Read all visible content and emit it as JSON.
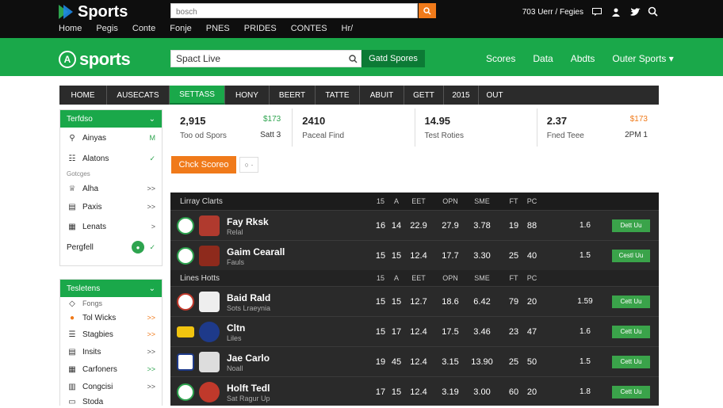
{
  "top": {
    "logo": "Sports",
    "nav": [
      "Home",
      "Pegis",
      "Conte",
      "Fonje",
      "PNES",
      "PRIDES",
      "CONTES",
      "Hr/"
    ],
    "search_placeholder": "bosch",
    "user_text": "703 Uerr / Fegies"
  },
  "header": {
    "logo": "sports",
    "search_value": "Spact Live",
    "get_button": "Gatd Spores",
    "links": [
      "Scores",
      "Data",
      "Abdts",
      "Outer Sports ▾"
    ]
  },
  "tabs": [
    {
      "label": "HOME",
      "active": false
    },
    {
      "label": "AUSECATS",
      "active": false
    },
    {
      "label": "SETTASS",
      "active": true
    },
    {
      "label": "HONY",
      "active": false
    },
    {
      "label": "BEERT",
      "active": false
    },
    {
      "label": "TATTE",
      "active": false
    },
    {
      "label": "ABUIT",
      "active": false
    },
    {
      "label": "GETT",
      "active": false
    },
    {
      "label": "2015",
      "active": false
    },
    {
      "label": "OUT",
      "active": false
    }
  ],
  "sidebar1": {
    "title": "Terfdso",
    "items": [
      {
        "label": "Ainyas",
        "right": "M"
      },
      {
        "label": "Alatons",
        "right": "✓"
      },
      {
        "label": "Alha",
        "right": ">>"
      },
      {
        "label": "Paxis",
        "right": ">>"
      },
      {
        "label": "Lenats",
        "right": ">"
      },
      {
        "label": "Pergfell",
        "right": "✓"
      }
    ],
    "sub": "Gotcges"
  },
  "sidebar2": {
    "title": "Tesletens",
    "items": [
      {
        "label": "Fongs",
        "right": ""
      },
      {
        "label": "Tol Wicks",
        "right": ">>"
      },
      {
        "label": "Stagbies",
        "right": ">>"
      },
      {
        "label": "Insits",
        "right": ">>"
      },
      {
        "label": "Carfoners",
        "right": ">>"
      },
      {
        "label": "Congcisi",
        "right": ">>"
      },
      {
        "label": "Stoda",
        "right": ""
      }
    ]
  },
  "stats": [
    {
      "value": "2,915",
      "label": "Too od Spors",
      "side": "$173",
      "side2": "Satt 3"
    },
    {
      "value": "2410",
      "label": "Paceal Find",
      "side": "",
      "side2": ""
    },
    {
      "value": "14.95",
      "label": "Test Roties",
      "side": "",
      "side2": ""
    },
    {
      "value": "2.37",
      "label": "Fned Teee",
      "side": "$173",
      "side2": "2PM 1"
    }
  ],
  "check_button": "Chck Scoreo",
  "check_toggle": "○ ·",
  "table": {
    "header1": {
      "title": "Lirray Clarts",
      "cols": [
        "15",
        "A",
        "EET",
        "OPN",
        "SME",
        "FT",
        "PC"
      ]
    },
    "header2": {
      "title": "Lines Hotts",
      "cols": [
        "15",
        "A",
        "EET",
        "OPN",
        "SME",
        "FT",
        "PC"
      ]
    },
    "rows": [
      {
        "name": "Fay Rksk",
        "sub": "Relal",
        "vals": [
          "16",
          "14",
          "22.9",
          "27.9",
          "3.78",
          "19",
          "88"
        ],
        "odds": "1.6",
        "btn": "Dett Uu"
      },
      {
        "name": "Gaim Cearall",
        "sub": "Fauls",
        "vals": [
          "15",
          "15",
          "12.4",
          "17.7",
          "3.30",
          "25",
          "40"
        ],
        "odds": "1.5",
        "btn": "Cestl Uu"
      },
      {
        "name": "Baid Rald",
        "sub": "Sots Lraeynia",
        "vals": [
          "15",
          "15",
          "12.7",
          "18.6",
          "6.42",
          "79",
          "20"
        ],
        "odds": "1.59",
        "btn": "Cett Uu"
      },
      {
        "name": "Cltn",
        "sub": "Liles",
        "vals": [
          "15",
          "17",
          "12.4",
          "17.5",
          "3.46",
          "23",
          "47"
        ],
        "odds": "1.6",
        "btn": "Cett Uu"
      },
      {
        "name": "Jae Carlo",
        "sub": "Noall",
        "vals": [
          "19",
          "45",
          "12.4",
          "3.15",
          "13.90",
          "25",
          "50"
        ],
        "odds": "1.5",
        "btn": "Cett Uu"
      },
      {
        "name": "Holft Tedl",
        "sub": "Sat Ragur Up",
        "vals": [
          "17",
          "15",
          "12.4",
          "3.19",
          "3.00",
          "60",
          "20"
        ],
        "odds": "1.8",
        "btn": "Cett Uu"
      }
    ]
  },
  "colors": {
    "green": "#1aa84a",
    "orange": "#f07a1a",
    "dark": "#2a2a2a"
  }
}
